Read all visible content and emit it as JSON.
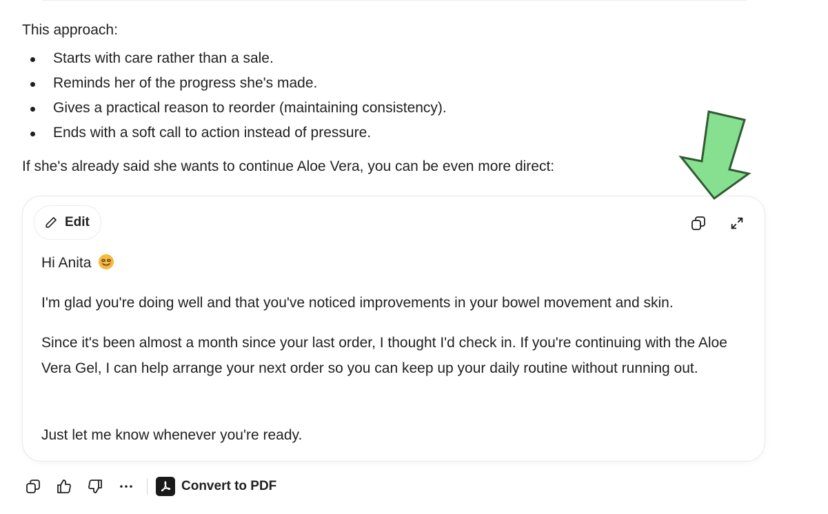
{
  "response": {
    "intro": "This approach:",
    "points": [
      "Starts with care rather than a sale.",
      "Reminds her of the progress she's made.",
      "Gives a practical reason to reorder (maintaining consistency).",
      "Ends with a soft call to action instead of pressure."
    ],
    "followup": "If she's already said she wants to continue Aloe Vera, you can be even more direct:"
  },
  "draft_card": {
    "edit_label": "Edit",
    "copy_icon": "copy-icon",
    "expand_icon": "expand-icon",
    "greeting": "Hi Anita",
    "greeting_emoji": "😊",
    "paragraphs": [
      "I'm glad you're doing well and that you've noticed improvements in your bowel movement and skin.",
      "Since it's been almost a month since your last order, I thought I'd check in. If you're continuing with the Aloe Vera Gel, I can help arrange your next order so you can keep up your daily routine without running out.",
      "Just let me know whenever you're ready."
    ]
  },
  "annotation": {
    "arrow_color": "#86e08f",
    "arrow_stroke": "#2f5a34",
    "points_to": "copy-icon"
  },
  "action_bar": {
    "icons": [
      "copy-icon",
      "thumbs-up-icon",
      "thumbs-down-icon",
      "more-icon"
    ],
    "convert_label": "Convert to PDF",
    "convert_icon": "acrobat-icon"
  }
}
